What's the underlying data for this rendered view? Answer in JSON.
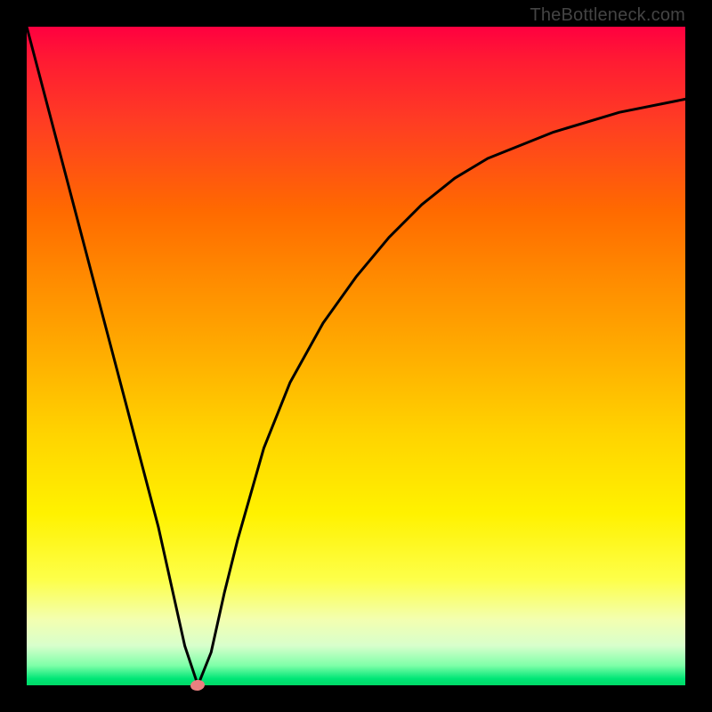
{
  "watermark": {
    "text": "TheBottleneck.com"
  },
  "colors": {
    "top": "#ff0040",
    "mid1": "#ff8a00",
    "mid2": "#ffd400",
    "mid3": "#fdff4a",
    "bottom": "#00d966",
    "curve_stroke": "#000000",
    "marker_fill": "#e98080",
    "frame_bg": "#000000"
  },
  "chart_data": {
    "type": "line",
    "title": "",
    "xlabel": "",
    "ylabel": "",
    "xlim": [
      0,
      100
    ],
    "ylim": [
      0,
      100
    ],
    "grid": false,
    "legend": false,
    "x": [
      0,
      5,
      10,
      15,
      20,
      24,
      26,
      28,
      30,
      32,
      36,
      40,
      45,
      50,
      55,
      60,
      65,
      70,
      80,
      90,
      100
    ],
    "values": [
      100,
      81,
      62,
      43,
      24,
      6,
      0,
      5,
      14,
      22,
      36,
      46,
      55,
      62,
      68,
      73,
      77,
      80,
      84,
      87,
      89
    ],
    "marker": {
      "x": 26,
      "y": 0
    }
  }
}
